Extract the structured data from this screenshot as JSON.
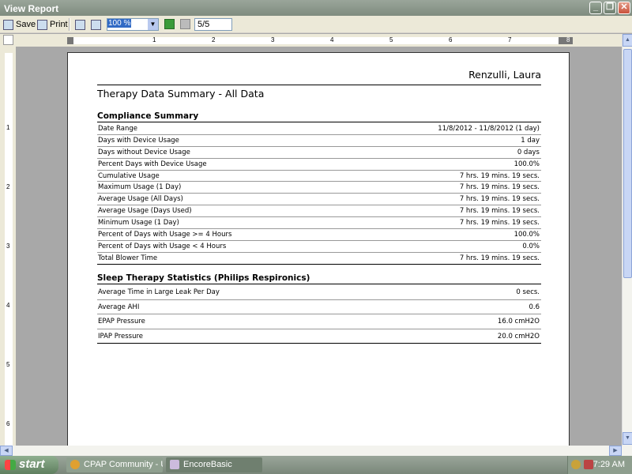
{
  "window": {
    "title": "View Report"
  },
  "toolbar": {
    "save_label": "Save",
    "print_label": "Print",
    "zoom_value": "100 %",
    "page_indicator": "5/5"
  },
  "ruler": {
    "h_numbers": [
      "1",
      "2",
      "3",
      "4",
      "5",
      "6",
      "7",
      "8"
    ],
    "v_numbers": [
      "1",
      "2",
      "3",
      "4",
      "5",
      "6"
    ]
  },
  "report": {
    "patient_name": "Renzulli, Laura",
    "title": "Therapy Data Summary - All Data",
    "compliance": {
      "heading": "Compliance Summary",
      "rows": [
        {
          "label": "Date Range",
          "value": "11/8/2012 - 11/8/2012 (1 day)"
        },
        {
          "label": "Days with Device Usage",
          "value": "1 day"
        },
        {
          "label": "Days without Device Usage",
          "value": "0 days"
        },
        {
          "label": "Percent Days with Device Usage",
          "value": "100.0%"
        },
        {
          "label": "Cumulative Usage",
          "value": "7 hrs. 19 mins. 19 secs."
        },
        {
          "label": "Maximum Usage (1 Day)",
          "value": "7 hrs. 19 mins. 19 secs."
        },
        {
          "label": "Average Usage (All Days)",
          "value": "7 hrs. 19 mins. 19 secs."
        },
        {
          "label": "Average Usage (Days Used)",
          "value": "7 hrs. 19 mins. 19 secs."
        },
        {
          "label": "Minimum Usage (1 Day)",
          "value": "7 hrs. 19 mins. 19 secs."
        },
        {
          "label": "Percent of Days with Usage >= 4 Hours",
          "value": "100.0%"
        },
        {
          "label": "Percent of Days with Usage < 4 Hours",
          "value": "0.0%"
        },
        {
          "label": "Total Blower Time",
          "value": "7 hrs. 19 mins. 19 secs."
        }
      ]
    },
    "sleep": {
      "heading": "Sleep Therapy Statistics (Philips Respironics)",
      "rows": [
        {
          "label": "Average Time in Large Leak Per Day",
          "value": "0 secs."
        },
        {
          "label": "Average AHI",
          "value": "0.6"
        },
        {
          "label": "EPAP Pressure",
          "value": "16.0 cmH2O"
        },
        {
          "label": "IPAP Pressure",
          "value": "20.0 cmH2O"
        }
      ]
    }
  },
  "taskbar": {
    "start_label": "start",
    "items": [
      {
        "label": "CPAP Community - Us..."
      },
      {
        "label": "EncoreBasic"
      }
    ],
    "clock": "7:29 AM"
  }
}
